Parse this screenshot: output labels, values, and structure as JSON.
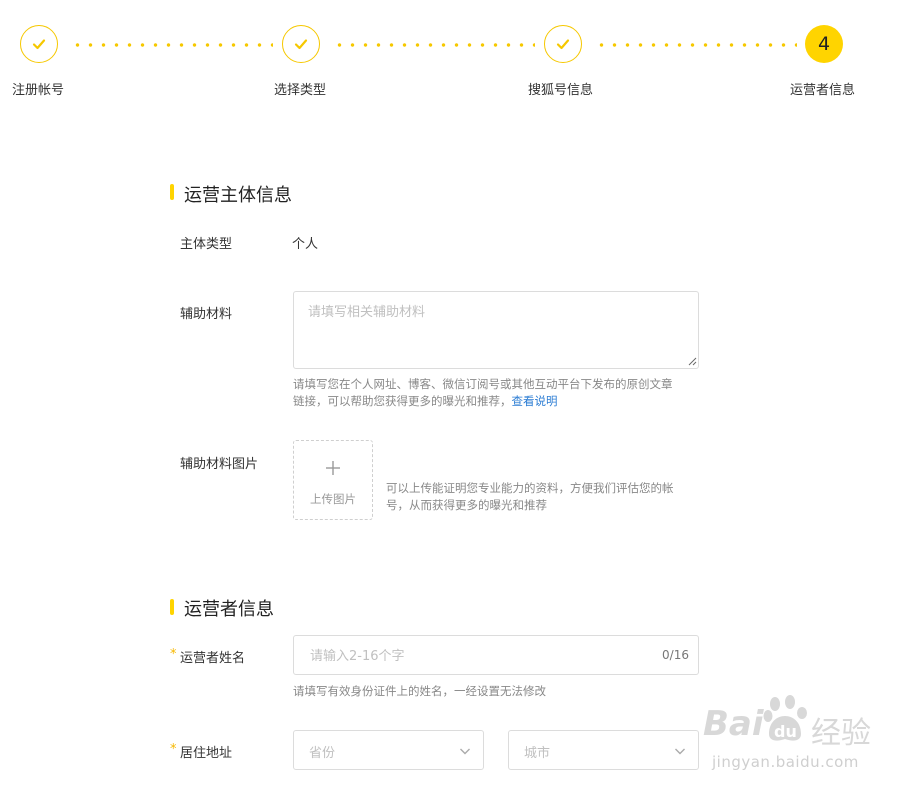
{
  "stepper": {
    "steps": [
      {
        "label": "注册帐号",
        "status": "done"
      },
      {
        "label": "选择类型",
        "status": "done"
      },
      {
        "label": "搜狐号信息",
        "status": "done"
      },
      {
        "label": "运营者信息",
        "status": "active",
        "number": "4"
      }
    ],
    "accent_color": "#ffd400"
  },
  "section_entity": {
    "title": "运营主体信息",
    "entity_type_label": "主体类型",
    "entity_type_value": "个人",
    "material_label": "辅助材料",
    "material_placeholder": "请填写相关辅助材料",
    "material_hint_line1": "请填写您在个人网址、博客、微信订阅号或其他互动平台下发布的原创文章",
    "material_hint_line2": "链接，可以帮助您获得更多的曝光和推荐，",
    "material_hint_link": "查看说明",
    "image_label": "辅助材料图片",
    "upload_icon": "plus-icon",
    "upload_text": "上传图片",
    "upload_hint": "可以上传能证明您专业能力的资料，方便我们评估您的帐号，从而获得更多的曝光和推荐"
  },
  "section_operator": {
    "title": "运营者信息",
    "required_mark": "*",
    "name_label": "运营者姓名",
    "name_placeholder": "请输入2-16个字",
    "name_counter": "0/16",
    "name_hint": "请填写有效身份证件上的姓名，一经设置无法修改",
    "address_label": "居住地址",
    "province_placeholder": "省份",
    "city_placeholder": "城市"
  },
  "watermark": {
    "logo_text_left": "Bai",
    "logo_text_du": "du",
    "logo_text_right": "经验",
    "url": "jingyan.baidu.com"
  }
}
